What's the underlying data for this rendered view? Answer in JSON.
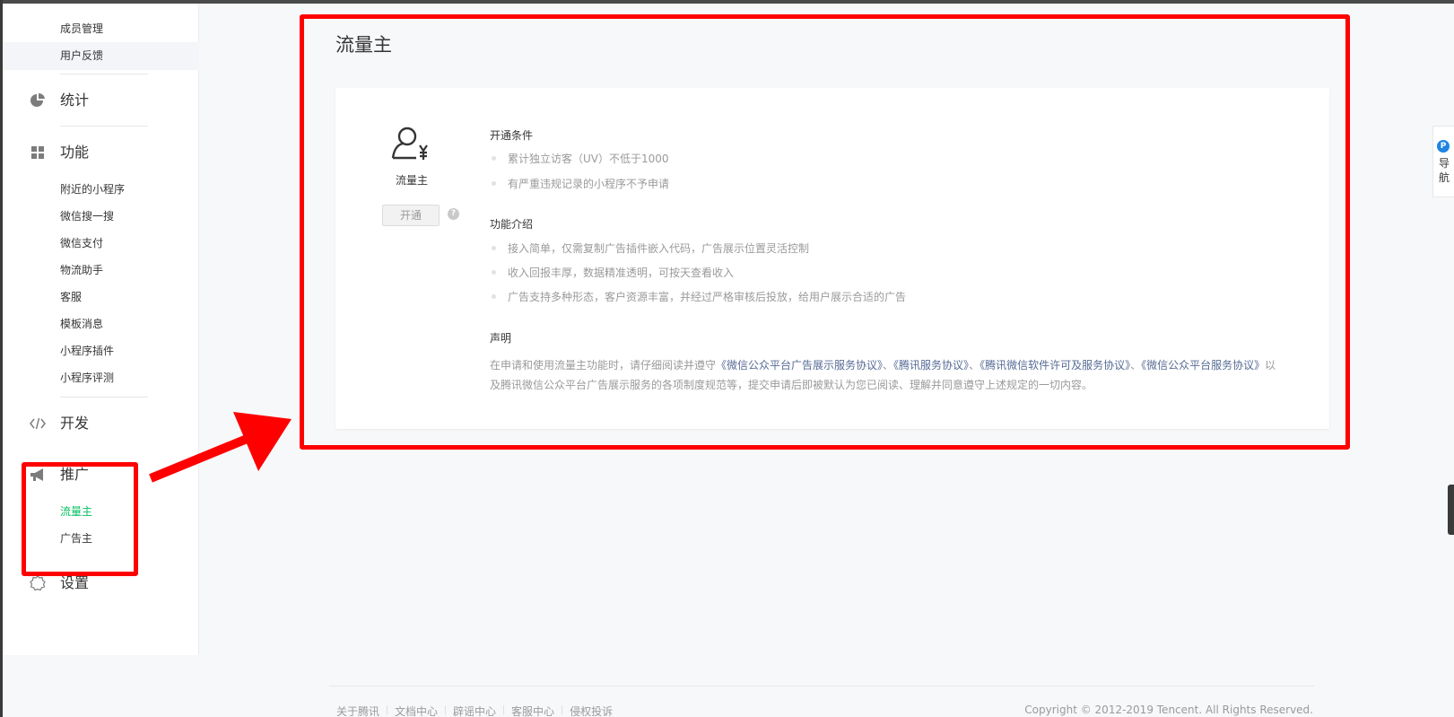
{
  "sidebar": {
    "top_items": [
      "成员管理",
      "用户反馈"
    ],
    "stats": "统计",
    "features": "功能",
    "feature_items": [
      "附近的小程序",
      "微信搜一搜",
      "微信支付",
      "物流助手",
      "客服",
      "模板消息",
      "小程序插件",
      "小程序评测"
    ],
    "develop": "开发",
    "promote": "推广",
    "promote_items": [
      "流量主",
      "广告主"
    ],
    "settings": "设置"
  },
  "page": {
    "title": "流量主",
    "card": {
      "name": "流量主",
      "open_button": "开通",
      "help_icon": "?",
      "conditions_title": "开通条件",
      "conditions": [
        "累计独立访客（UV）不低于1000",
        "有严重违规记录的小程序不予申请"
      ],
      "intro_title": "功能介绍",
      "intro": [
        "接入简单，仅需复制广告插件嵌入代码，广告展示位置灵活控制",
        "收入回报丰厚，数据精准透明，可按天查看收入",
        "广告支持多种形态，客户资源丰富，并经过严格审核后投放，给用户展示合适的广告"
      ],
      "statement_title": "声明",
      "statement_prefix": "在申请和使用流量主功能时，请仔细阅读并遵守",
      "statement_links": [
        "《微信公众平台广告展示服务协议》",
        "《腾讯服务协议》",
        "《腾讯微信软件许可及服务协议》",
        "《微信公众平台服务协议》"
      ],
      "statement_sep": "、",
      "statement_suffix": "以及腾讯微信公众平台广告展示服务的各项制度规范等，提交申请后即被默认为您已阅读、理解并同意遵守上述规定的一切内容。"
    }
  },
  "float_nav": {
    "icon": "P",
    "label": "导航"
  },
  "footer": {
    "links": [
      "关于腾讯",
      "文档中心",
      "辟谣中心",
      "客服中心",
      "侵权投诉"
    ],
    "copyright": "Copyright © 2012-2019 Tencent. All Rights Reserved."
  },
  "colors": {
    "accent": "#07c160",
    "link": "#576b95",
    "annotation": "#fe0000"
  }
}
